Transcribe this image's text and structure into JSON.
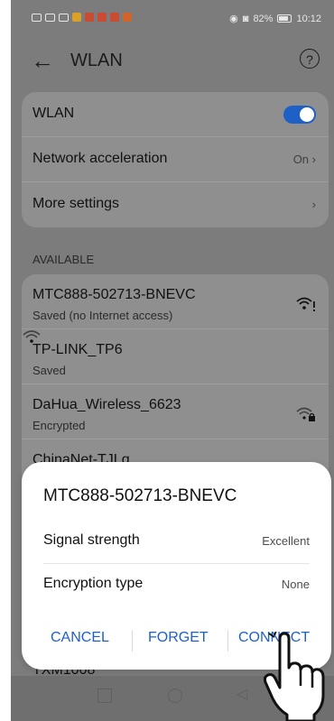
{
  "statusbar": {
    "battery": "82%",
    "time": "10:12"
  },
  "header": {
    "title": "WLAN"
  },
  "settings": {
    "wlan_label": "WLAN",
    "network_acceleration_label": "Network acceleration",
    "network_acceleration_value": "On",
    "more_settings_label": "More settings"
  },
  "section": {
    "available_label": "AVAILABLE"
  },
  "networks": [
    {
      "name": "MTC888-502713-BNEVC",
      "status": "Saved (no Internet access)"
    },
    {
      "name": "TP-LINK_TP6",
      "status": "Saved"
    },
    {
      "name": "DaHua_Wireless_6623",
      "status": "Encrypted"
    },
    {
      "name": "ChinaNet-TJLq",
      "status": ""
    },
    {
      "name": "TXM1008",
      "status": ""
    }
  ],
  "dialog": {
    "title": "MTC888-502713-BNEVC",
    "signal_strength_label": "Signal strength",
    "signal_strength_value": "Excellent",
    "encryption_type_label": "Encryption type",
    "encryption_type_value": "None",
    "cancel_label": "CANCEL",
    "forget_label": "FORGET",
    "connect_label": "CONNECT"
  },
  "colors": {
    "accent": "#1f60c4",
    "dialog_button": "#1c5fd0"
  }
}
